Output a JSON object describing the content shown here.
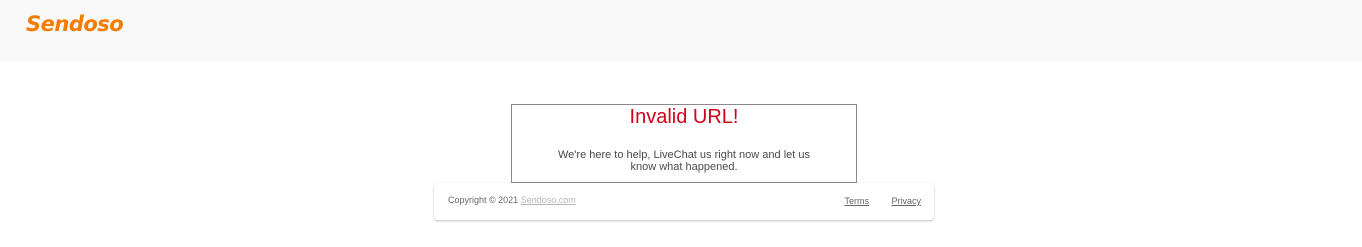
{
  "colors": {
    "brand": "#f57c00",
    "error": "#d0021b"
  },
  "header": {
    "logo_text": "Sendoso"
  },
  "error": {
    "title": "Invalid URL!",
    "message": "We're here to help, LiveChat us right now and let us know what happened."
  },
  "footer": {
    "copyright_prefix": "Copyright © 2021",
    "copyright_link": "Sendoso.com",
    "terms_label": "Terms",
    "privacy_label": "Privacy"
  }
}
